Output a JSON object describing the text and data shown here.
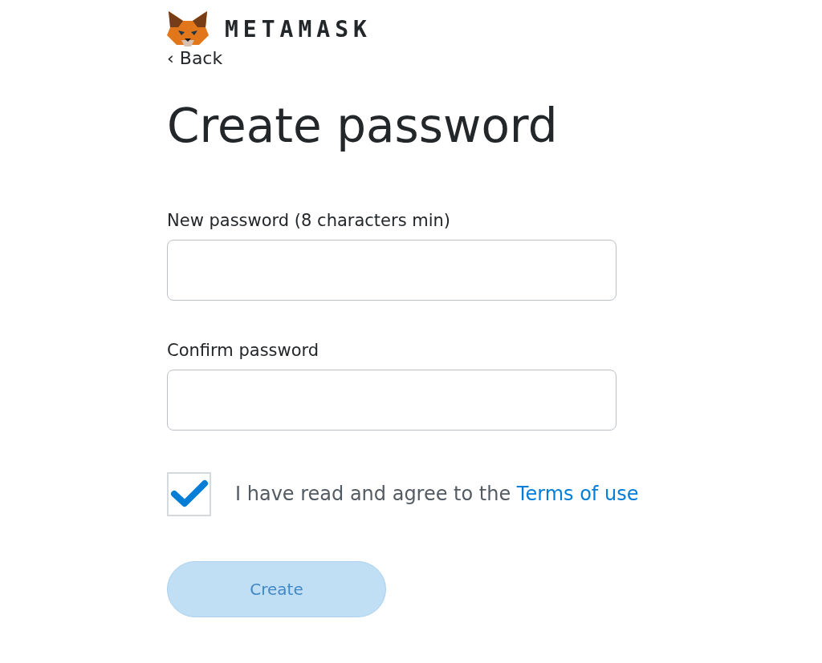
{
  "brand": {
    "name": "METAMASK"
  },
  "back": {
    "label": "‹ Back"
  },
  "title": "Create password",
  "fields": [
    {
      "label": "New password (8 characters min)"
    },
    {
      "label": "Confirm password"
    }
  ],
  "terms": {
    "checked": true,
    "text": "I have read and agree to the ",
    "link": "Terms of use"
  },
  "create_button": {
    "label": "Create",
    "disabled": true
  }
}
